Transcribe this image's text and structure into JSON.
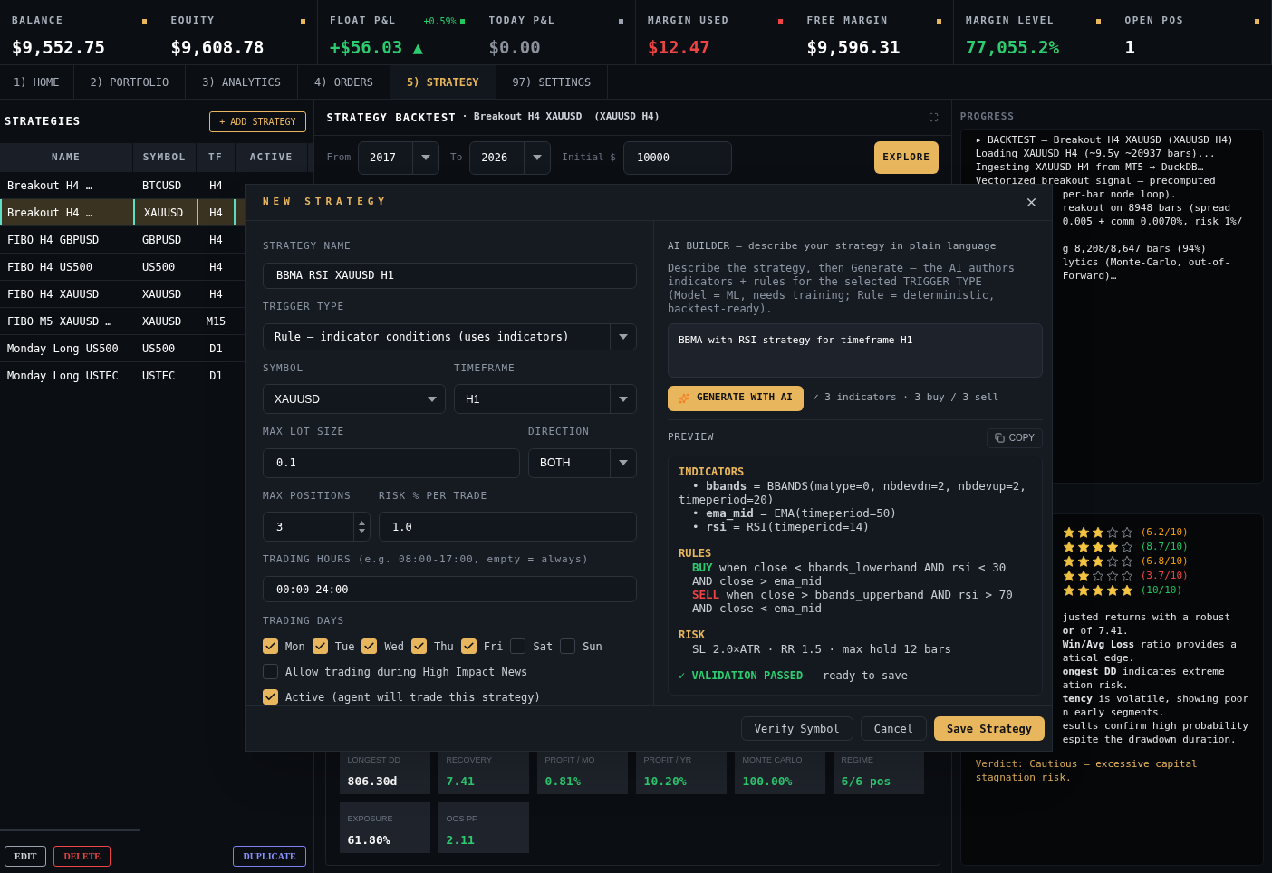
{
  "top_stats": [
    {
      "label": "BALANCE",
      "dot": {
        "color": "#e8b65c"
      },
      "value": "$9,552.75",
      "color": "#ffffff"
    },
    {
      "label": "EQUITY",
      "dot": {
        "color": "#e8b65c"
      },
      "value": "$9,608.78",
      "color": "#ffffff"
    },
    {
      "label": "FLOAT P&L",
      "change": "+0.59%",
      "dot": {
        "color": "#22c55e"
      },
      "value": "+$56.03 ▲",
      "color": "#2ecc71"
    },
    {
      "label": "TODAY P&L",
      "dot": {
        "color": "#9ca3af"
      },
      "value": "$0.00",
      "color": "#8b929c"
    },
    {
      "label": "MARGIN USED",
      "dot": {
        "color": "#ef4444"
      },
      "value": "$12.47",
      "color": "#ef4444"
    },
    {
      "label": "FREE MARGIN",
      "dot": {
        "color": "#e8b65c"
      },
      "value": "$9,596.31",
      "color": "#ffffff"
    },
    {
      "label": "MARGIN LEVEL",
      "dot": {
        "color": "#e8b65c"
      },
      "value": "77,055.2%",
      "color": "#2ecc71"
    },
    {
      "label": "OPEN POS",
      "dot": {
        "color": "#e8b65c"
      },
      "value": "1",
      "color": "#ffffff"
    }
  ],
  "tabs": [
    {
      "label": "1) HOME",
      "selected": false
    },
    {
      "label": "2) PORTFOLIO",
      "selected": false
    },
    {
      "label": "3) ANALYTICS",
      "selected": false
    },
    {
      "label": "4) ORDERS",
      "selected": false
    },
    {
      "label": "5) STRATEGY",
      "selected": true
    },
    {
      "label": "97) SETTINGS",
      "selected": false
    }
  ],
  "strategies": {
    "title": "STRATEGIES",
    "add_button": "+ ADD STRATEGY",
    "columns": [
      "NAME",
      "SYMBOL",
      "TF",
      "ACTIVE"
    ],
    "rows": [
      {
        "name": "Breakout H4 …",
        "symbol": "BTCUSD",
        "tf": "H4",
        "selected": false
      },
      {
        "name": "Breakout H4 …",
        "symbol": "XAUUSD",
        "tf": "H4",
        "selected": true
      },
      {
        "name": "FIBO H4 GBPUSD",
        "symbol": "GBPUSD",
        "tf": "H4",
        "selected": false
      },
      {
        "name": "FIBO H4 US500",
        "symbol": "US500",
        "tf": "H4",
        "selected": false
      },
      {
        "name": "FIBO H4 XAUUSD",
        "symbol": "XAUUSD",
        "tf": "H4",
        "selected": false
      },
      {
        "name": "FIBO M5 XAUUSD …",
        "symbol": "XAUUSD",
        "tf": "M15",
        "selected": false
      },
      {
        "name": "Monday Long US500",
        "symbol": "US500",
        "tf": "D1",
        "selected": false
      },
      {
        "name": "Monday Long USTEC",
        "symbol": "USTEC",
        "tf": "D1",
        "selected": false
      }
    ],
    "buttons": [
      {
        "label": "EDIT",
        "kind": "neutral"
      },
      {
        "label": "DELETE",
        "kind": "danger"
      },
      {
        "label": "DUPLICATE",
        "kind": "accent"
      }
    ]
  },
  "backtest": {
    "title": "STRATEGY BACKTEST",
    "subtitle": "· Breakout H4 XAUUSD  (XAUUSD H4)",
    "from_label": "From",
    "from": "2017",
    "to_label": "To",
    "to": "2026",
    "initial_label": "Initial $",
    "initial": "10000",
    "explore_button": "EXPLORE",
    "metrics": [
      {
        "label": "LONGEST DD",
        "value": "806.30d",
        "color": "#ffffff"
      },
      {
        "label": "RECOVERY",
        "value": "7.41",
        "color": "#2ecc71"
      },
      {
        "label": "PROFIT / MO",
        "value": "0.81%",
        "color": "#2ecc71"
      },
      {
        "label": "PROFIT / YR",
        "value": "10.20%",
        "color": "#2ecc71"
      },
      {
        "label": "MONTE CARLO",
        "value": "100.00%",
        "color": "#2ecc71"
      },
      {
        "label": "REGIME",
        "value": "6/6 pos",
        "color": "#2ecc71"
      },
      {
        "label": "EXPOSURE",
        "value": "61.80%",
        "color": "#ffffff"
      },
      {
        "label": "OOS PF",
        "value": "2.11",
        "color": "#2ecc71"
      }
    ]
  },
  "progress": {
    "title": "PROGRESS",
    "log": [
      "▸ BACKTEST — Breakout H4 XAUUSD (XAUUSD H4)",
      "Loading XAUUSD H4 (~9.5y ~20937 bars)...",
      "Ingesting XAUUSD H4 from MT5 → DuckDB…",
      "Vectorized breakout signal — precomputed"
    ],
    "log_covered": [
      {
        "lines": [
          "per-bar node loop).",
          "reakout on 8948 bars (spread",
          "0.005 + comm 0.0070%, risk 1%/"
        ]
      },
      {
        "lines": [
          "g 8,208/8,647 bars (94%)",
          "lytics (Monte-Carlo, out-of-",
          "Forward)…"
        ]
      }
    ]
  },
  "ratings": [
    {
      "stars": 3,
      "score": "(6.2/10)",
      "color": "#f59e0b"
    },
    {
      "stars": 4,
      "score": "(8.7/10)",
      "color": "#22c55e"
    },
    {
      "stars": 3,
      "score": "(6.8/10)",
      "color": "#f59e0b"
    },
    {
      "stars": 2,
      "score": "(3.7/10)",
      "color": "#ef4444"
    },
    {
      "stars": 5,
      "score": "(10/10)",
      "color": "#22c55e"
    }
  ],
  "analysis": [
    "justed returns with a robust",
    "**or** of 7.41.",
    "**Win/Avg Loss** ratio provides a",
    "atical edge.",
    "**ongest DD** indicates extreme",
    "ation risk.",
    "**tency** is volatile, showing poor",
    "n early segments.",
    "esults confirm high probability",
    "espite the drawdown duration."
  ],
  "verdict": "Verdict: Cautious — excessive capital stagnation risk.",
  "modal": {
    "title": "NEW STRATEGY",
    "name_field": {
      "label": "STRATEGY NAME",
      "value": "BBMA RSI XAUUSD H1"
    },
    "trigger_type": {
      "label": "TRIGGER TYPE",
      "value": "Rule — indicator conditions (uses indicators)"
    },
    "symbol": {
      "label": "SYMBOL",
      "value": "XAUUSD"
    },
    "timeframe": {
      "label": "TIMEFRAME",
      "value": "H1"
    },
    "max_lot_size": {
      "label": "MAX LOT SIZE",
      "value": "0.1"
    },
    "direction": {
      "label": "DIRECTION",
      "value": "BOTH"
    },
    "max_positions": {
      "label": "MAX POSITIONS",
      "value": "3"
    },
    "risk_per_trade": {
      "label": "RISK % PER TRADE",
      "value": "1.0"
    },
    "trading_hours": {
      "label": "TRADING HOURS (e.g. 08:00-17:00, empty = always)",
      "value": "00:00-24:00"
    },
    "trading_days": {
      "label": "TRADING DAYS",
      "days": [
        {
          "label": "Mon",
          "checked": true
        },
        {
          "label": "Tue",
          "checked": true
        },
        {
          "label": "Wed",
          "checked": true
        },
        {
          "label": "Thu",
          "checked": true
        },
        {
          "label": "Fri",
          "checked": true
        },
        {
          "label": "Sat",
          "checked": false
        },
        {
          "label": "Sun",
          "checked": false
        }
      ]
    },
    "options": [
      {
        "label": "Allow trading during High Impact News",
        "checked": false
      },
      {
        "label": "Active (agent will trade this strategy)",
        "checked": true
      }
    ],
    "ai_builder": {
      "title": "AI BUILDER — describe your strategy in plain language",
      "description": "Describe the strategy, then Generate — the AI authors indicators + rules for the selected TRIGGER TYPE (Model = ML, needs training; Rule = deterministic, backtest-ready).",
      "prompt": "BBMA with RSI strategy for timeframe H1",
      "generate_button": "GENERATE WITH AI",
      "result": "✓ 3 indicators · 3 buy / 3 sell"
    },
    "preview": {
      "label": "PREVIEW",
      "copy_button": "COPY",
      "sections": [
        {
          "heading": "INDICATORS",
          "lines": [
            {
              "kind": "plain",
              "text": "• **bbands** = BBANDS(matype=0, nbdevdn=2, nbdevup=2, timeperiod=20)"
            },
            {
              "kind": "plain",
              "text": "• **ema_mid** = EMA(timeperiod=50)"
            },
            {
              "kind": "plain",
              "text": "• **rsi** = RSI(timeperiod=14)"
            }
          ]
        },
        {
          "heading": "RULES",
          "lines": [
            {
              "kind": "buy",
              "side": "BUY",
              "text": "when close < bbands_lowerband AND rsi < 30 AND close > ema_mid"
            },
            {
              "kind": "sell",
              "side": "SELL",
              "text": "when close > bbands_upperband AND rsi > 70 AND close < ema_mid"
            }
          ]
        },
        {
          "heading": "RISK",
          "lines": [
            {
              "kind": "plain",
              "text": "SL 2.0×ATR · RR 1.5 · max hold 12 bars"
            }
          ]
        }
      ],
      "validation": {
        "mark": "✓",
        "status": "VALIDATION PASSED",
        "note": "— ready to save",
        "passed": true
      }
    },
    "buttons": [
      {
        "label": "Verify Symbol",
        "kind": "secondary"
      },
      {
        "label": "Cancel",
        "kind": "secondary"
      },
      {
        "label": "Save Strategy",
        "kind": "primary"
      }
    ]
  }
}
